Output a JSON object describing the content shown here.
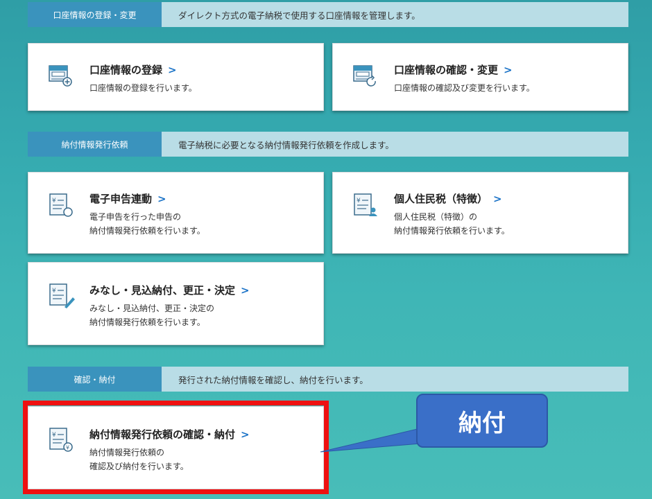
{
  "sections": [
    {
      "tag": "口座情報の登録・変更",
      "desc": "ダイレクト方式の電子納税で使用する口座情報を管理します。"
    },
    {
      "tag": "納付情報発行依頼",
      "desc": "電子納税に必要となる納付情報発行依頼を作成します。"
    },
    {
      "tag": "確認・納付",
      "desc": "発行された納付情報を確認し、納付を行います。"
    }
  ],
  "cards": {
    "account_register": {
      "title": "口座情報の登録",
      "chevron": ">",
      "desc1": "口座情報の登録を行います。",
      "icon": "bank-card-add-icon"
    },
    "account_confirm": {
      "title": "口座情報の確認・変更",
      "chevron": ">",
      "desc1": "口座情報の確認及び変更を行います。",
      "icon": "bank-card-refresh-icon"
    },
    "e_filing": {
      "title": "電子申告連動",
      "chevron": ">",
      "desc1": "電子申告を行った申告の",
      "desc2": "納付情報発行依頼を行います。",
      "icon": "document-yen-search-icon"
    },
    "resident_tax": {
      "title": "個人住民税（特徴）",
      "chevron": ">",
      "desc1": "個人住民税（特徴）の",
      "desc2": "納付情報発行依頼を行います。",
      "icon": "document-yen-person-icon"
    },
    "deemed_payment": {
      "title": "みなし・見込納付、更正・決定",
      "chevron": ">",
      "desc1": "みなし・見込納付、更正・決定の",
      "desc2": "納付情報発行依頼を行います。",
      "icon": "document-yen-pen-icon"
    },
    "confirm_payment": {
      "title": "納付情報発行依頼の確認・納付",
      "chevron": ">",
      "desc1": "納付情報発行依頼の",
      "desc2": "確認及び納付を行います。",
      "icon": "document-yen-coin-icon"
    }
  },
  "callout": {
    "text": "納付"
  },
  "colors": {
    "accent": "#3a93bd",
    "highlight": "#ee1111",
    "callout": "#3a6fc8",
    "chevron": "#1b73c7"
  }
}
